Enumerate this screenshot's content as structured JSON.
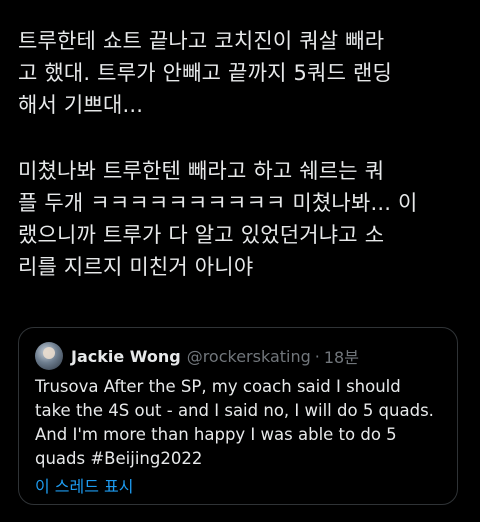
{
  "tweet": {
    "paragraph1": [
      "트루한테 쇼트 끝나고 코치진이 쿼살 빼라",
      "고 했대. 트루가 안빼고 끝까지 5쿼드 랜딩",
      "해서 기쁘대..."
    ],
    "paragraph2": [
      "미쳤나봐 트루한텐 빼라고 하고 쉐르는 쿼",
      "플 두개 ㅋㅋㅋㅋㅋㅋㅋㅋㅋㅋ 미쳤나봐... 이",
      "랬으니까 트루가 다 알고 있었던거냐고 소",
      "리를 지르지 미친거 아니야"
    ]
  },
  "quote": {
    "avatar_icon": "avatar",
    "name": "Jackie Wong",
    "handle": "@rockerskating",
    "separator": "·",
    "time": "18분",
    "body": [
      "Trusova After the SP, my coach said I should",
      "take the 4S out - and I said no, I will do 5 quads.",
      "And I'm more than happy I was able to do 5",
      "quads #Beijing2022"
    ],
    "show_thread": "이 스레드 표시"
  },
  "colors": {
    "background": "#000000",
    "text": "#e7e9ea",
    "secondary": "#71767b",
    "link": "#1d9bf0",
    "border": "#2f3336"
  }
}
